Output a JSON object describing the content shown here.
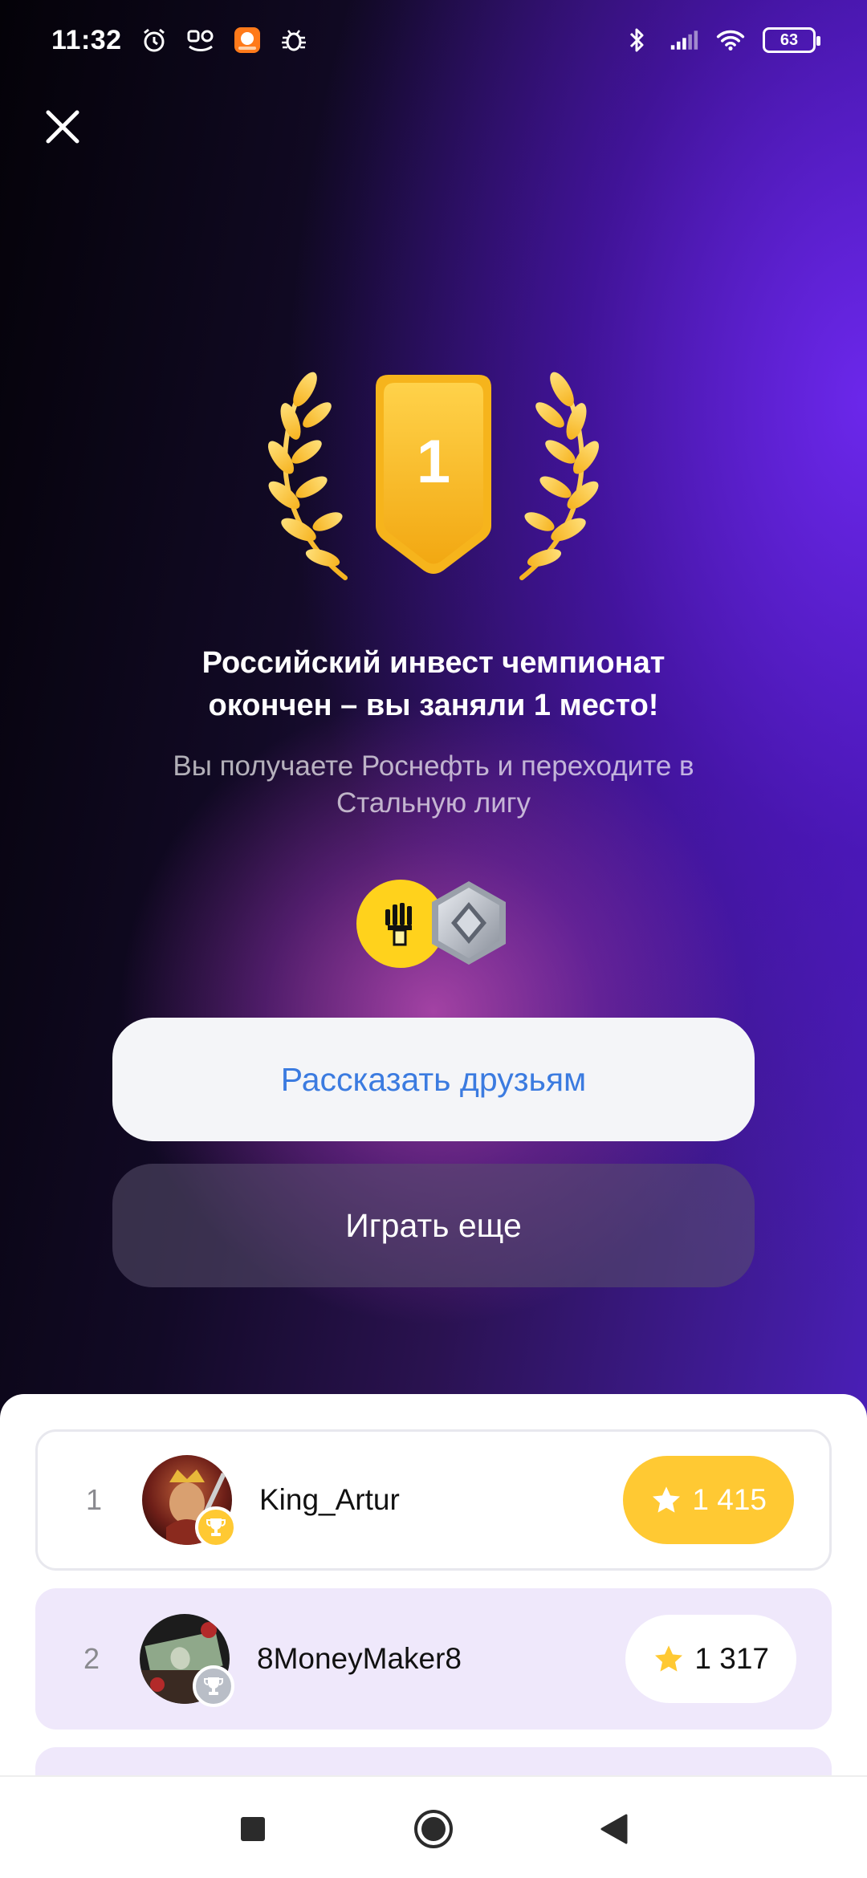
{
  "status_bar": {
    "time": "11:32",
    "battery": "63",
    "icons": [
      "alarm-icon",
      "app-notification-icon",
      "app-icon",
      "bug-icon",
      "bluetooth-icon",
      "signal-icon",
      "wifi-icon",
      "battery-icon"
    ]
  },
  "result": {
    "place_badge": "1",
    "headline_line1": "Российский инвест чемпионат",
    "headline_line2": "окончен – вы заняли 1 место!",
    "subline_line1": "Вы получаете Роснефть и переходите в",
    "subline_line2": "Стальную лигу"
  },
  "buttons": {
    "share_label": "Рассказать друзьям",
    "play_label": "Играть еще"
  },
  "leaderboard": [
    {
      "rank": "1",
      "name": "King_Artur",
      "score": "1 415",
      "cup": "gold"
    },
    {
      "rank": "2",
      "name": "8MoneyMaker8",
      "score": "1 317",
      "cup": "silver"
    }
  ],
  "colors": {
    "accent_gold": "#ffc933",
    "link_blue": "#3b7be0",
    "row_highlight": "#efe8fb"
  }
}
